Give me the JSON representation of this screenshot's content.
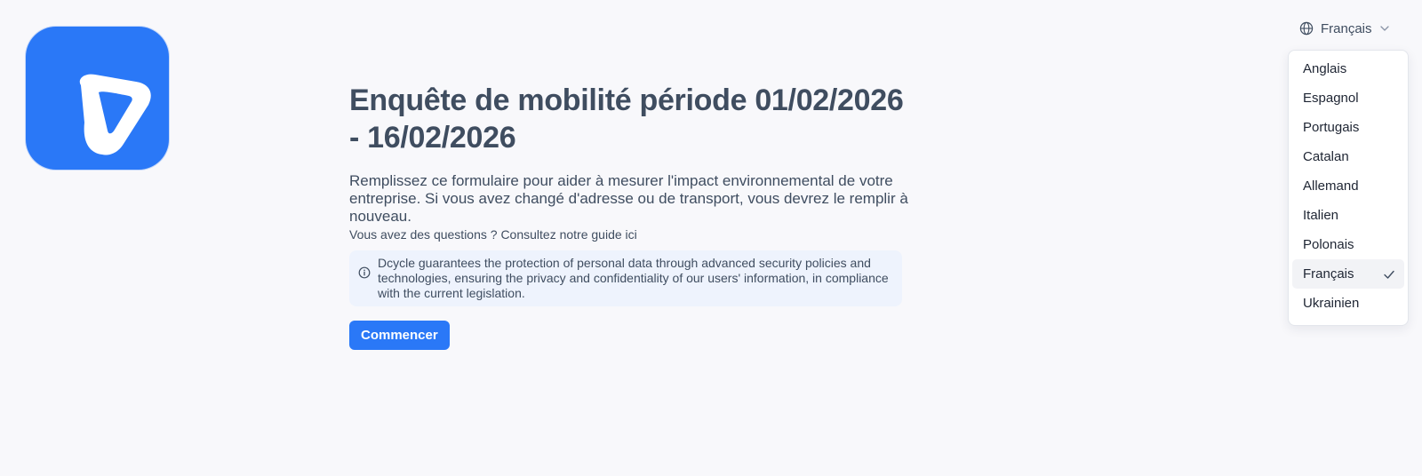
{
  "logo": {
    "icon": "dcycle-logo-icon",
    "color": "#2a78f7"
  },
  "survey": {
    "title": "Enquête de mobilité période 01/02/2026 - 16/02/2026",
    "description": "Remplissez ce formulaire pour aider à mesurer l'impact environnemental de votre entreprise. Si vous avez changé d'adresse ou de transport, vous devrez le remplir à nouveau.",
    "guide_text": "Vous avez des questions ? Consultez notre guide ici",
    "privacy_notice": "Dcycle guarantees the protection of personal data through advanced security policies and technologies, ensuring the privacy and confidentiality of our users' information, in compliance with the current legislation.",
    "start_label": "Commencer"
  },
  "language": {
    "current": "Français",
    "icon": "globe-icon",
    "options": [
      {
        "label": "Anglais",
        "selected": false
      },
      {
        "label": "Espagnol",
        "selected": false
      },
      {
        "label": "Portugais",
        "selected": false
      },
      {
        "label": "Catalan",
        "selected": false
      },
      {
        "label": "Allemand",
        "selected": false
      },
      {
        "label": "Italien",
        "selected": false
      },
      {
        "label": "Polonais",
        "selected": false
      },
      {
        "label": "Français",
        "selected": true
      },
      {
        "label": "Ukrainien",
        "selected": false
      }
    ]
  },
  "colors": {
    "accent": "#2a78f7",
    "notice_bg": "#eef3fd",
    "text": "#3f4d60"
  }
}
